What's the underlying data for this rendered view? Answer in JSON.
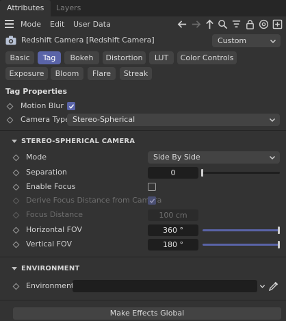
{
  "tabs": {
    "attributes": "Attributes",
    "layers": "Layers"
  },
  "menu": {
    "mode": "Mode",
    "edit": "Edit",
    "user_data": "User Data"
  },
  "object": {
    "title": "Redshift Camera [Redshift Camera]",
    "preset": "Custom"
  },
  "tag_tabs": {
    "basic": "Basic",
    "tag": "Tag",
    "bokeh": "Bokeh",
    "distortion": "Distortion",
    "lut": "LUT",
    "color_controls": "Color Controls",
    "exposure": "Exposure",
    "bloom": "Bloom",
    "flare": "Flare",
    "streak": "Streak"
  },
  "tag_properties": {
    "heading": "Tag Properties",
    "motion_blur_label": "Motion Blur",
    "motion_blur_checked": true,
    "camera_type_label": "Camera Type",
    "camera_type_value": "Stereo-Spherical"
  },
  "stereo": {
    "heading": "STEREO-SPHERICAL CAMERA",
    "mode_label": "Mode",
    "mode_value": "Side By Side",
    "separation_label": "Separation",
    "separation_value": "0",
    "separation_fraction": 0.0,
    "enable_focus_label": "Enable Focus",
    "enable_focus_checked": false,
    "derive_focus_label": "Derive Focus Distance from Camera",
    "derive_focus_checked": true,
    "focus_distance_label": "Focus Distance",
    "focus_distance_value": "100 cm",
    "hfov_label": "Horizontal FOV",
    "hfov_value": "360 °",
    "hfov_fraction": 1.0,
    "vfov_label": "Vertical FOV",
    "vfov_value": "180 °",
    "vfov_fraction": 1.0
  },
  "environment": {
    "heading": "ENVIRONMENT",
    "env_label": "Environment",
    "env_value": ""
  },
  "footer": {
    "make_global": "Make Effects Global"
  },
  "colors": {
    "accent": "#5a64a8",
    "panel": "#333333",
    "field": "#1e1e1e",
    "button": "#434343"
  },
  "icons": [
    "menu-icon",
    "arrow-left-icon",
    "arrow-right-icon",
    "arrow-up-icon",
    "search-icon",
    "filter-icon",
    "lock-icon",
    "target-icon",
    "add-icon",
    "camera-icon",
    "chevron-down-icon",
    "diamond-keyframe-icon",
    "eyedropper-icon",
    "check-icon"
  ]
}
